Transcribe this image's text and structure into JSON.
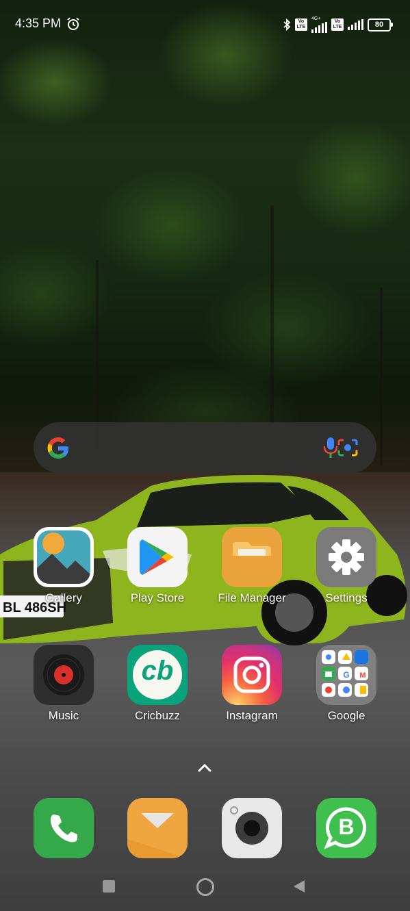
{
  "status_bar": {
    "time": "4:35 PM",
    "alarm_icon": "alarm-clock-icon",
    "bluetooth_icon": "bluetooth-icon",
    "sim1_badge": "Vo LTE",
    "sim1_net": "4G+",
    "sim2_badge": "Vo LTE",
    "battery": "80"
  },
  "search_bar": {
    "logo_icon": "google-g-icon",
    "mic_icon": "mic-icon",
    "lens_icon": "camera-lens-icon"
  },
  "apps_row1": [
    {
      "label": "Gallery",
      "icon": "gallery-icon"
    },
    {
      "label": "Play Store",
      "icon": "play-store-icon"
    },
    {
      "label": "File Manager",
      "icon": "folder-icon"
    },
    {
      "label": "Settings",
      "icon": "gear-icon"
    }
  ],
  "apps_row2": [
    {
      "label": "Music",
      "icon": "vinyl-record-icon"
    },
    {
      "label": "Cricbuzz",
      "icon": "cricbuzz-icon"
    },
    {
      "label": "Instagram",
      "icon": "instagram-icon"
    },
    {
      "label": "Google",
      "icon": "google-folder-icon"
    }
  ],
  "cricbuzz_logo_text": "cb",
  "dock": [
    {
      "name": "phone",
      "icon": "phone-icon"
    },
    {
      "name": "messages",
      "icon": "envelope-icon"
    },
    {
      "name": "camera",
      "icon": "camera-icon"
    },
    {
      "name": "whatsapp-business",
      "icon": "whatsapp-business-icon"
    }
  ],
  "whatsapp_business_letter": "B",
  "app_drawer_icon": "chevron-up-icon",
  "nav_bar": {
    "recent": "square-icon",
    "home": "circle-icon",
    "back": "triangle-back-icon"
  },
  "colors": {
    "search_bg": "#303030",
    "folder_orange": "#e9a33a",
    "settings_gray": "#7a7a7a",
    "cricbuzz_green": "#0aa37a",
    "dock_green": "#35a84a",
    "whatsapp_green": "#3fbf4e"
  }
}
